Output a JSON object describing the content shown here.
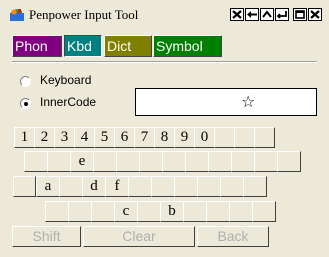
{
  "window": {
    "title": "Penpower Input Tool",
    "title_buttons": [
      "close-icon",
      "left-arrow-icon",
      "up-caret-icon",
      "enter-icon",
      "restore-icon",
      "close-icon"
    ]
  },
  "tabs": [
    {
      "label": "Phon",
      "color": "#800080"
    },
    {
      "label": "Kbd",
      "color": "#008080",
      "selected": true
    },
    {
      "label": "Dict",
      "color": "#808000"
    },
    {
      "label": "Symbol",
      "color": "#008000"
    }
  ],
  "mode": {
    "keyboard_label": "Keyboard",
    "innercode_label": "InnerCode",
    "selected": "InnerCode"
  },
  "code_display": {
    "value": "☆"
  },
  "keyboard": {
    "row1": [
      "1",
      "2",
      "3",
      "4",
      "5",
      "6",
      "7",
      "8",
      "9",
      "0",
      "",
      "",
      ""
    ],
    "row2": [
      "",
      "",
      "e",
      "",
      "",
      "",
      "",
      "",
      "",
      "",
      "",
      ""
    ],
    "row3": [
      "",
      "a",
      "",
      "d",
      "f",
      "",
      "",
      "",
      "",
      "",
      ""
    ],
    "row4": [
      "",
      "",
      "",
      "c",
      "",
      "b",
      "",
      "",
      "",
      ""
    ],
    "shift_label": "Shift",
    "clear_label": "Clear",
    "back_label": "Back"
  }
}
